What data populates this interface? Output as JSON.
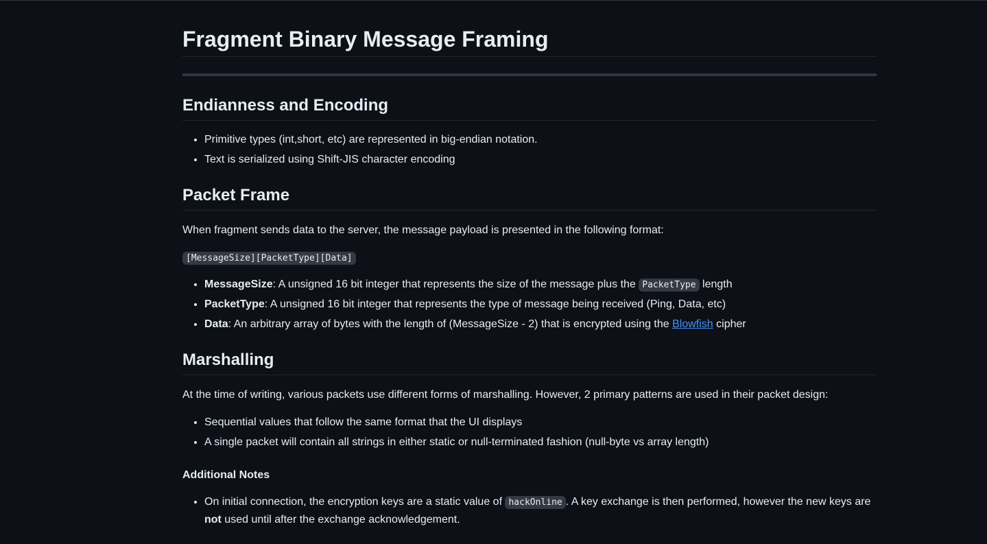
{
  "title": "Fragment Binary Message Framing",
  "endianness": {
    "heading": "Endianness and Encoding",
    "items": [
      "Primitive types (int,short, etc) are represented in big-endian notation.",
      "Text is serialized using Shift-JIS character encoding"
    ]
  },
  "packet_frame": {
    "heading": "Packet Frame",
    "intro": "When fragment sends data to the server, the message payload is presented in the following format:",
    "format_code": "[MessageSize][PacketType][Data]",
    "items": [
      {
        "term": "MessageSize",
        "text": ": A unsigned 16 bit integer that represents the size of the message plus the ",
        "code": "PacketType",
        "tail": " length"
      },
      {
        "term": "PacketType",
        "text": ": A unsigned 16 bit integer that represents the type of message being received (Ping, Data, etc)"
      },
      {
        "term": "Data",
        "text": ": An arbitrary array of bytes with the length of (MessageSize - 2) that is encrypted using the ",
        "link": "Blowfish",
        "tail": " cipher"
      }
    ]
  },
  "marshalling": {
    "heading": "Marshalling",
    "intro": "At the time of writing, various packets use different forms of marshalling. However, 2 primary patterns are used in their packet design:",
    "items": [
      "Sequential values that follow the same format that the UI displays",
      "A single packet will contain all strings in either static or null-terminated fashion (null-byte vs array length)"
    ]
  },
  "notes": {
    "heading": "Additional Notes",
    "item": {
      "text1": "On initial connection, the encryption keys are a static value of ",
      "code": "hackOnline",
      "text2": ". A key exchange is then performed, however the new keys are ",
      "bold": "not",
      "text3": " used until after the exchange acknowledgement."
    }
  }
}
